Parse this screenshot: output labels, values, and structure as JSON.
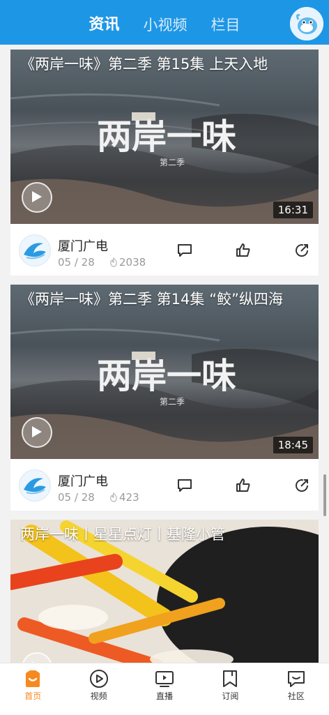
{
  "header": {
    "tabs": [
      {
        "label": "资讯",
        "active": true
      },
      {
        "label": "小视频",
        "active": false
      },
      {
        "label": "栏目",
        "active": false
      }
    ],
    "accent": "#1e96e6"
  },
  "feed": [
    {
      "title": "《两岸一味》第二季 第15集 上天入地",
      "duration": "16:31",
      "source": "厦门广电",
      "date": "05 / 28",
      "views": "2038"
    },
    {
      "title": "《两岸一味》第二季 第14集 “鲛”纵四海",
      "duration": "18:45",
      "source": "厦门广电",
      "date": "05 / 28",
      "views": "423"
    },
    {
      "title": "两岸一味丨星星点灯丨基隆小管"
    }
  ],
  "bottom_nav": [
    {
      "label": "首页",
      "icon": "home-icon",
      "active": true
    },
    {
      "label": "视频",
      "icon": "video-play-icon",
      "active": false
    },
    {
      "label": "直播",
      "icon": "live-tv-icon",
      "active": false
    },
    {
      "label": "订阅",
      "icon": "bookmark-icon",
      "active": false
    },
    {
      "label": "社区",
      "icon": "community-chat-icon",
      "active": false
    }
  ],
  "colors": {
    "active_nav": "#f7891e"
  }
}
